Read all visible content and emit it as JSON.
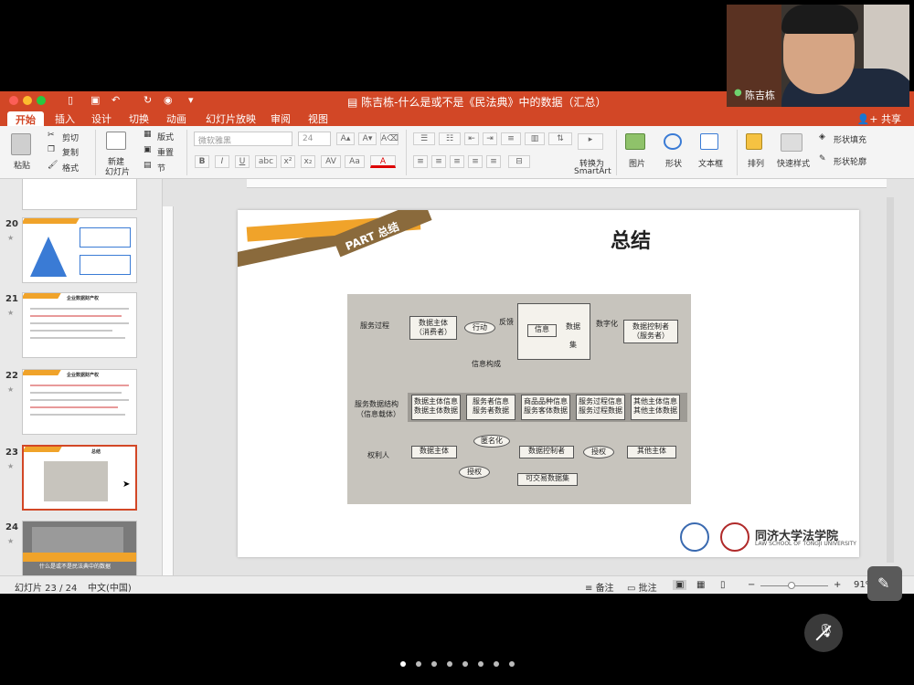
{
  "window": {
    "title": "陈吉栋-什么是或不是《民法典》中的数据（汇总）"
  },
  "tabs": [
    {
      "label": "开始",
      "active": true
    },
    {
      "label": "插入"
    },
    {
      "label": "设计"
    },
    {
      "label": "切换"
    },
    {
      "label": "动画"
    },
    {
      "label": "幻灯片放映"
    },
    {
      "label": "审阅"
    },
    {
      "label": "视图"
    }
  ],
  "share_label": "共享",
  "ribbon": {
    "paste": "粘贴",
    "cut": "剪切",
    "copy": "复制",
    "format": "格式",
    "new_slide_line1": "新建",
    "new_slide_line2": "幻灯片",
    "layout": "版式",
    "reset": "重置",
    "section": "节",
    "font_name": "微软雅黑",
    "font_size": "24",
    "convert_line1": "转换为",
    "convert_line2": "SmartArt",
    "picture": "图片",
    "shape": "形状",
    "textbox": "文本框",
    "arrange": "排列",
    "quick_styles": "快速样式",
    "shape_fill": "形状填充",
    "shape_outline": "形状轮廓"
  },
  "thumbnails": [
    {
      "num": "20"
    },
    {
      "num": "21",
      "title": "企业数据财产权"
    },
    {
      "num": "22",
      "title": "企业数据财产权"
    },
    {
      "num": "23",
      "title": "总结",
      "selected": true
    },
    {
      "num": "24",
      "title": "什么是或不是民法典中的数据"
    }
  ],
  "slide": {
    "part_label": "PART 总结",
    "title": "总结",
    "law_school_name": "同济大学法学院",
    "law_school_en": "LAW SCHOOL OF TONGJI UNIVERSITY"
  },
  "figure": {
    "row_labels": {
      "service_process": "服务过程",
      "service_data_structure_1": "服务数据结构",
      "service_data_structure_2": "（信息载体）",
      "rights_holder": "权利人"
    },
    "data_subject_consumer_1": "数据主体",
    "data_subject_consumer_2": "（消费者）",
    "action": "行动",
    "feedback": "反馈",
    "info": "信息",
    "data": "数据",
    "dataset": "集",
    "digitize": "数字化",
    "controller_service_1": "数据控制者",
    "controller_service_2": "（服务者）",
    "info_composition": "信息构成",
    "categories": [
      {
        "info": "数据主体信息",
        "data": "数据主体数据"
      },
      {
        "info": "服务者信息",
        "data": "服务者数据"
      },
      {
        "info": "商品品种信息",
        "data": "服务客体数据"
      },
      {
        "info": "服务过程信息",
        "data": "服务过程数据"
      },
      {
        "info": "其他主体信息",
        "data": "其他主体数据"
      }
    ],
    "anonymize": "匿名化",
    "data_subject": "数据主体",
    "data_controller": "数据控制者",
    "authorize": "授权",
    "other_subject": "其他主体",
    "tradeable_dataset": "可交易数据集"
  },
  "status": {
    "slide_of": "幻灯片 23 / 24",
    "language": "中文(中国)",
    "notes": "备注",
    "comments": "批注",
    "zoom": "91%"
  },
  "video": {
    "name": "陈吉栋"
  },
  "page_dots": 8,
  "colors": {
    "accent": "#d24726",
    "ribbon_orange": "#f0a32a",
    "ribbon_brown": "#8a6a3c"
  }
}
